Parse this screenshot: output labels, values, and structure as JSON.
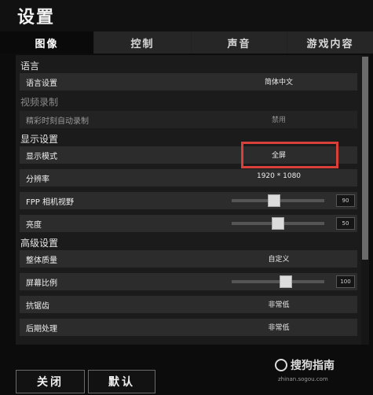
{
  "window": {
    "title": "设置"
  },
  "tabs": [
    {
      "label": "图像",
      "active": true
    },
    {
      "label": "控制",
      "active": false
    },
    {
      "label": "声音",
      "active": false
    },
    {
      "label": "游戏内容",
      "active": false
    }
  ],
  "sections": {
    "language": "语言",
    "video_recording": "视频录制",
    "display": "显示设置",
    "advanced": "高级设置"
  },
  "rows": {
    "language_setting": {
      "label": "语言设置",
      "value": "简体中文"
    },
    "highlight_recording": {
      "label": "精彩时刻自动录制",
      "value": "禁用"
    },
    "display_mode": {
      "label": "显示模式",
      "value": "全屏"
    },
    "resolution": {
      "label": "分辨率",
      "value": "1920 * 1080"
    },
    "fpp_fov": {
      "label": "FPP 相机视野",
      "value": "90",
      "fraction": 0.45
    },
    "brightness": {
      "label": "亮度",
      "value": "50",
      "fraction": 0.5
    },
    "overall_quality": {
      "label": "整体质量",
      "value": "自定义"
    },
    "screen_scale": {
      "label": "屏幕比例",
      "value": "100",
      "fraction": 0.6
    },
    "anti_aliasing": {
      "label": "抗锯齿",
      "value": "非常低"
    },
    "post_processing": {
      "label": "后期处理",
      "value": "非常低"
    }
  },
  "buttons": {
    "close": "关闭",
    "default": "默认"
  },
  "watermark": {
    "text": "搜狗指南",
    "url": "zhinan.sogou.com"
  },
  "colors": {
    "highlight_border": "#d9403a",
    "background": "#0c0c0c",
    "panel": "#1b1b1b"
  }
}
